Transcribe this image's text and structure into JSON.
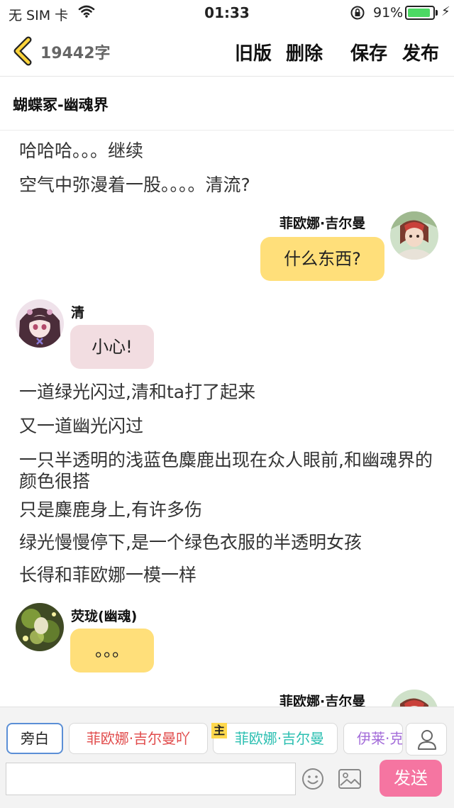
{
  "status_bar": {
    "carrier": "无 SIM 卡",
    "time": "01:33",
    "battery_percent": "91%",
    "battery_level": 0.91
  },
  "nav": {
    "word_count": "19442字",
    "actions": {
      "old_version": "旧版",
      "delete": "删除",
      "save": "保存",
      "publish": "发布"
    }
  },
  "story": {
    "title": "蝴蝶冢-幽魂界"
  },
  "messages": {
    "n1": "哈哈哈。。。继续",
    "n2": "空气中弥漫着一股。。。。清流?",
    "m1": {
      "name": "菲欧娜·吉尔曼",
      "text": "什么东西?"
    },
    "m2": {
      "name": "清",
      "text": "小心!"
    },
    "n3": "一道绿光闪过,清和ta打了起来",
    "n4": "又一道幽光闪过",
    "n5": "一只半透明的浅蓝色麋鹿出现在众人眼前,和幽魂界的颜色很搭",
    "n6": "只是麋鹿身上,有许多伤",
    "n7": "绿光慢慢停下,是一个绿色衣服的半透明女孩",
    "n8": "长得和菲欧娜一模一样",
    "m3": {
      "name": "荧珑(幽魂)",
      "text": "。。。"
    },
    "m4": {
      "name": "菲欧娜·吉尔曼"
    }
  },
  "bottom_bar": {
    "tabs": [
      "旁白",
      "菲欧娜·吉尔曼吖",
      "菲欧娜·吉尔曼",
      "伊莱·克"
    ],
    "main_badge": "主",
    "input_placeholder": "",
    "send_label": "发送"
  },
  "colors": {
    "accent_yellow": "#ffdf7a",
    "bubble_pink": "#f2dde1",
    "send_pink": "#f575a1",
    "active_tab_border": "#5b8fd6"
  }
}
